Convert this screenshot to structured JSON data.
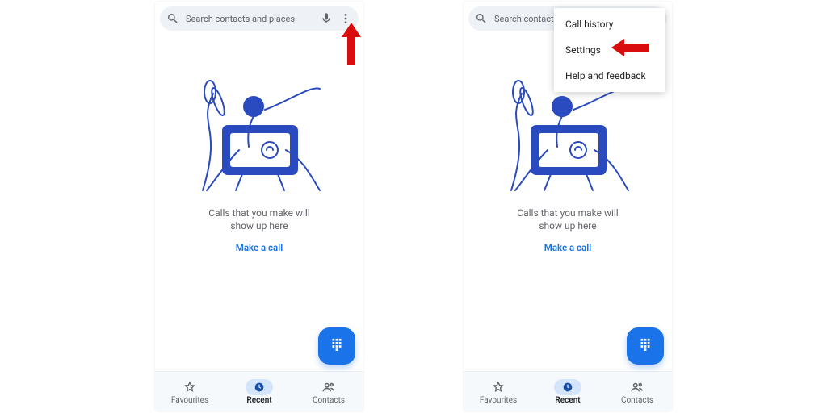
{
  "search": {
    "placeholder": "Search contacts and places"
  },
  "empty": {
    "message": "Calls that you make will\nshow up here",
    "cta": "Make a call"
  },
  "nav": {
    "favourites": "Favourites",
    "recent": "Recent",
    "contacts": "Contacts"
  },
  "menu": {
    "call_history": "Call history",
    "settings": "Settings",
    "help": "Help and feedback"
  },
  "colors": {
    "accent": "#1a73e8",
    "annotation": "#d90d0d"
  }
}
